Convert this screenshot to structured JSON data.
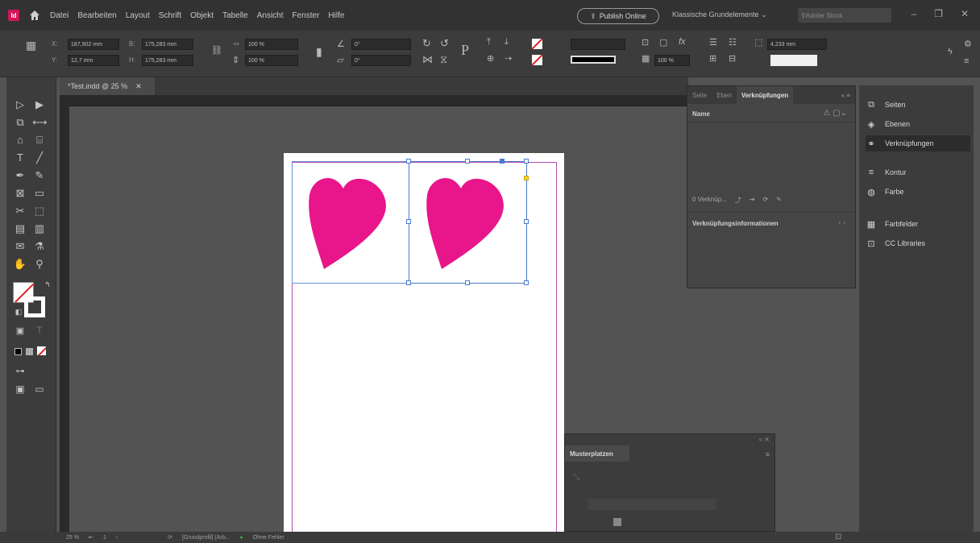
{
  "menu": {
    "items": [
      "Datei",
      "Bearbeiten",
      "Layout",
      "Schrift",
      "Objekt",
      "Tabelle",
      "Ansicht",
      "Fenster",
      "Hilfe"
    ],
    "publish": "Publish Online",
    "workspace": "Klassische Grundelemente",
    "search_placeholder": "Adobe Stock"
  },
  "control": {
    "x": "187,902 mm",
    "y": "12,7 mm",
    "w": "175,283 mm",
    "h": "175,283 mm",
    "scale_x": "100 %",
    "scale_y": "100 %",
    "angle": "0°",
    "shear": "0°",
    "opacity": "100 %",
    "stroke_weight": "4,233 mm"
  },
  "document": {
    "tab": "*Test.indd @ 25 %",
    "zoom": "25 %",
    "page": "1",
    "style": "[Grundprofil] (Arb...",
    "preflight": "Ohne Fehler"
  },
  "links_panel": {
    "tabs": [
      "Seite",
      "Eben",
      "Verknüpfungen"
    ],
    "name_header": "Name",
    "count": "0 Verknüp...",
    "info": "Verknüpfungsinformationen"
  },
  "dock": {
    "items": [
      "Seiten",
      "Ebenen",
      "Verknüpfungen",
      "Kontur",
      "Farbe",
      "Farbfelder",
      "CC Libraries"
    ],
    "active": "Verknüpfungen"
  },
  "pages_panel": {
    "title": "Musterplatzen"
  },
  "colors": {
    "heart": "#e8168a",
    "frame": "#4a7bd0",
    "margin": "#b44ca8"
  }
}
